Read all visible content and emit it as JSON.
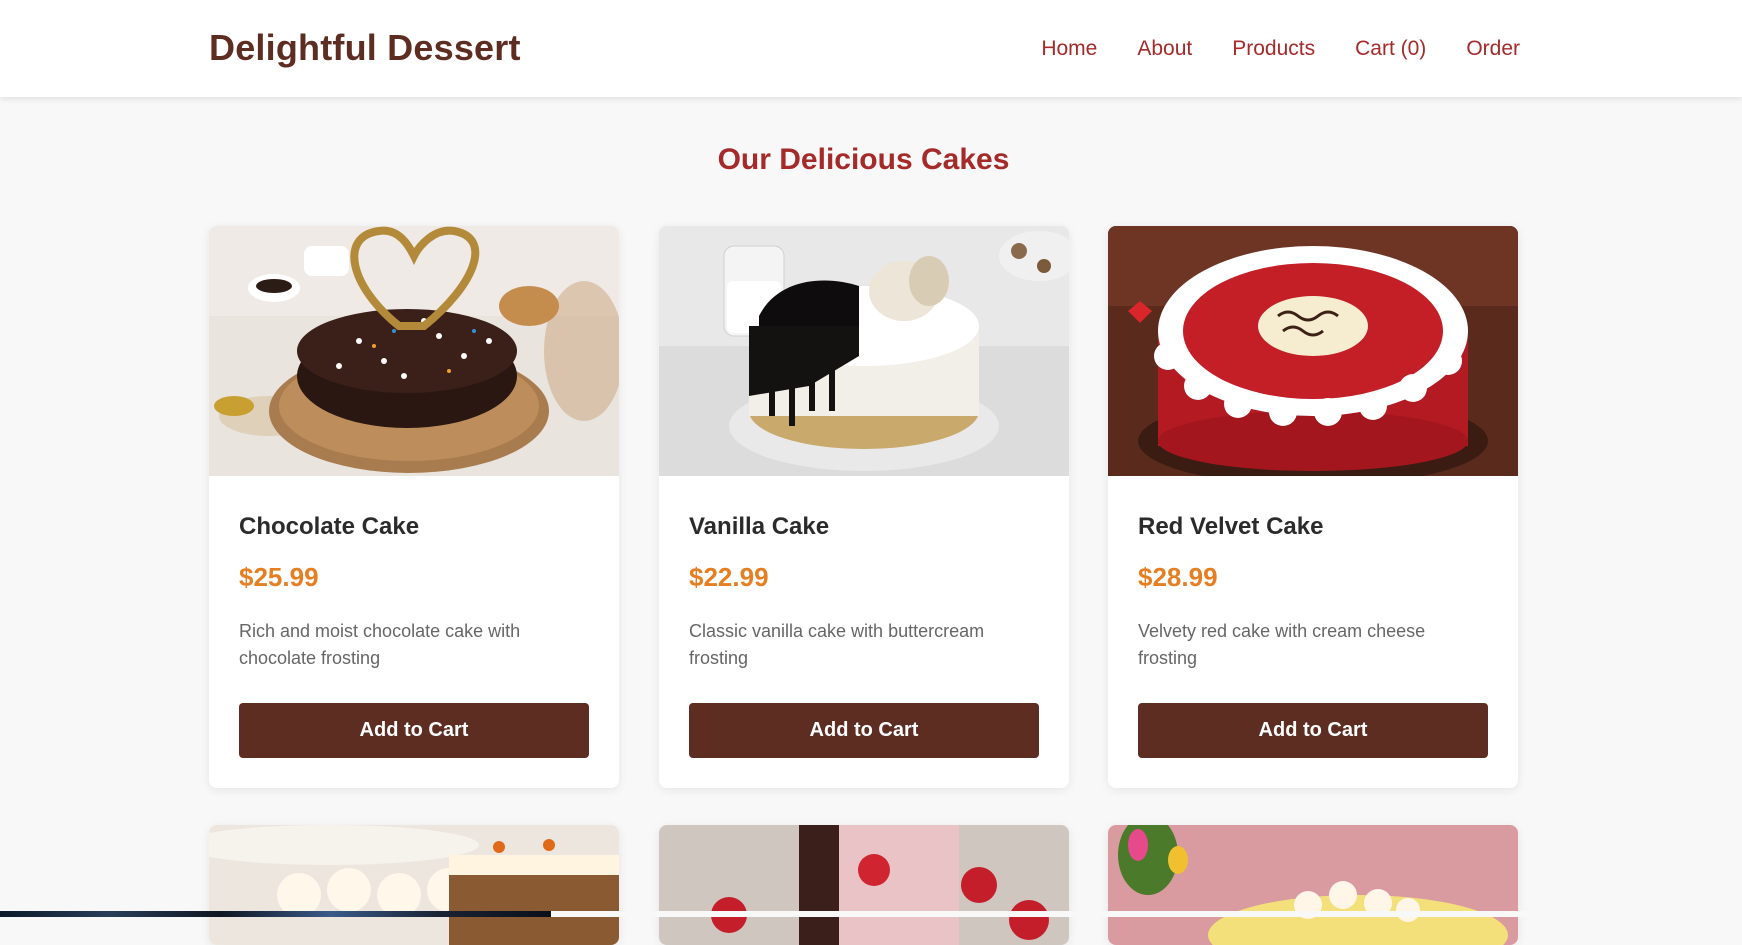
{
  "header": {
    "logo": "Delightful Dessert",
    "nav": [
      "Home",
      "About",
      "Products",
      "Cart (0)",
      "Order"
    ]
  },
  "main": {
    "title": "Our Delicious Cakes",
    "products": [
      {
        "name": "Chocolate Cake",
        "price": "$25.99",
        "description": "Rich and moist chocolate cake with chocolate frosting",
        "button": "Add to Cart"
      },
      {
        "name": "Vanilla Cake",
        "price": "$22.99",
        "description": "Classic vanilla cake with buttercream frosting",
        "button": "Add to Cart"
      },
      {
        "name": "Red Velvet Cake",
        "price": "$28.99",
        "description": "Velvety red cake with cream cheese frosting",
        "button": "Add to Cart"
      }
    ]
  },
  "colors": {
    "brand": "#5e2d22",
    "accent": "#a52a2a",
    "price": "#e67e22",
    "background": "#f8f8f8"
  }
}
